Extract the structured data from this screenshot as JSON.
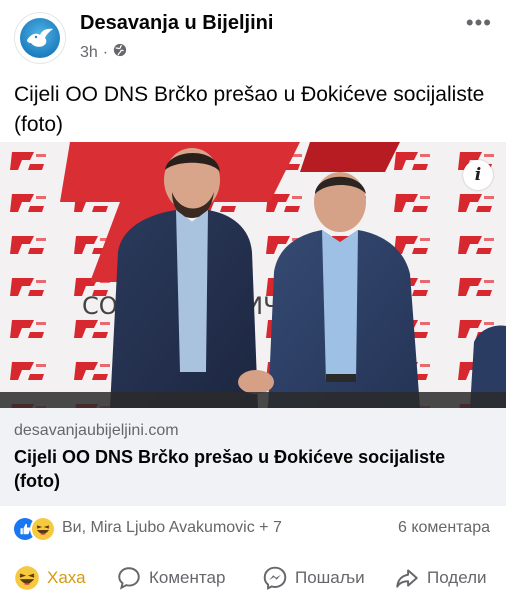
{
  "post": {
    "page_name": "Desavanja u Bijeljini",
    "time": "3h",
    "text": "Cijeli OO DNS Brčko prešao u Đokićeve socijaliste (foto)"
  },
  "photo": {
    "info_label": "i",
    "backdrop_text": "СОЦИЈАЛИСТИЧ"
  },
  "link": {
    "domain": "desavanjaubijeljini.com",
    "title": "Cijeli OO DNS Brčko prešao u Đokićeve socijaliste (foto)"
  },
  "reactions": {
    "names": "Ви, Mira Ljubo Avakumovic + 7",
    "comments": "6 коментара"
  },
  "actions": {
    "react_label": "Хаха",
    "comment_label": "Коментар",
    "send_label": "Пошаљи",
    "share_label": "Подели"
  },
  "colors": {
    "accent_blue": "#1877f2",
    "haha_yellow": "#f7c93e",
    "muted_text": "#65676b",
    "link_bg": "#f0f2f5",
    "party_red": "#d7282f"
  }
}
